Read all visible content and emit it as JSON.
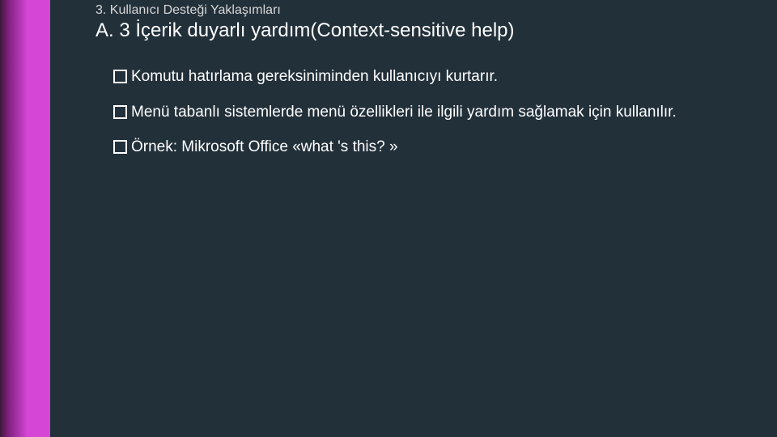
{
  "slide": {
    "breadcrumb": "3. Kullanıcı Desteği Yaklaşımları",
    "title": "A. 3 İçerik duyarlı yardım(Context-sensitive help)",
    "bullets": [
      "Komutu hatırlama gereksiniminden kullanıcıyı kurtarır.",
      "Menü tabanlı sistemlerde menü özellikleri ile ilgili yardım sağlamak için kullanılır.",
      "Örnek: Mikrosoft Office «what 's this? »"
    ]
  }
}
